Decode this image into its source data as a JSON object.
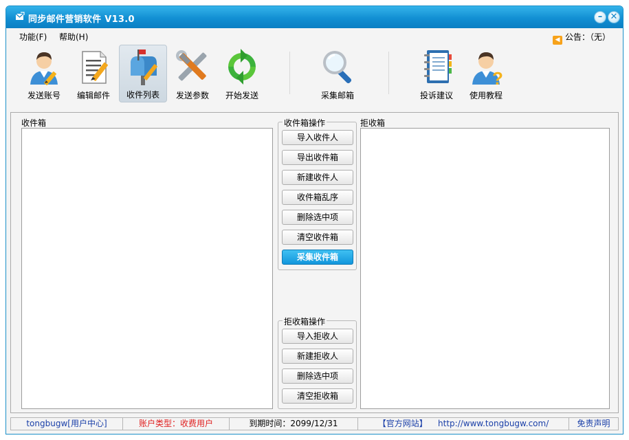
{
  "window": {
    "title": "同步邮件营销软件   V13.0"
  },
  "menu": {
    "function_label": "功能(F)",
    "help_label": "帮助(H)",
    "notice_label": "公告：（无）"
  },
  "toolbar": {
    "items": [
      {
        "label": "发送账号",
        "icon": "user-pencil-icon"
      },
      {
        "label": "编辑邮件",
        "icon": "document-edit-icon"
      },
      {
        "label": "收件列表",
        "icon": "mailbox-icon",
        "active": true
      },
      {
        "label": "发送参数",
        "icon": "tools-icon"
      },
      {
        "label": "开始发送",
        "icon": "refresh-arrows-icon"
      },
      {
        "label": "采集邮箱",
        "icon": "magnifier-icon"
      },
      {
        "label": "投诉建议",
        "icon": "notebook-icon"
      },
      {
        "label": "使用教程",
        "icon": "user-help-icon"
      }
    ]
  },
  "inbox": {
    "label": "收件箱"
  },
  "reject": {
    "label": "拒收箱"
  },
  "inbox_ops": {
    "title": "收件箱操作",
    "buttons": [
      "导入收件人",
      "导出收件箱",
      "新建收件人",
      "收件箱乱序",
      "删除选中项",
      "清空收件箱",
      "采集收件箱"
    ]
  },
  "reject_ops": {
    "title": "拒收箱操作",
    "buttons": [
      "导入拒收人",
      "新建拒收人",
      "删除选中项",
      "清空拒收箱"
    ]
  },
  "status": {
    "user": "tongbugw[用户中心]",
    "account_type": "账户类型：收费用户",
    "expiry": "到期时间：2099/12/31",
    "official_site": "【官方网站】",
    "url": "http://www.tongbugw.com/",
    "disclaimer": "免责声明"
  },
  "colors": {
    "title_bar": "#128fd3",
    "primary_button": "#1296dc",
    "status_red": "#e02020",
    "status_blue": "#1a3fa8"
  }
}
